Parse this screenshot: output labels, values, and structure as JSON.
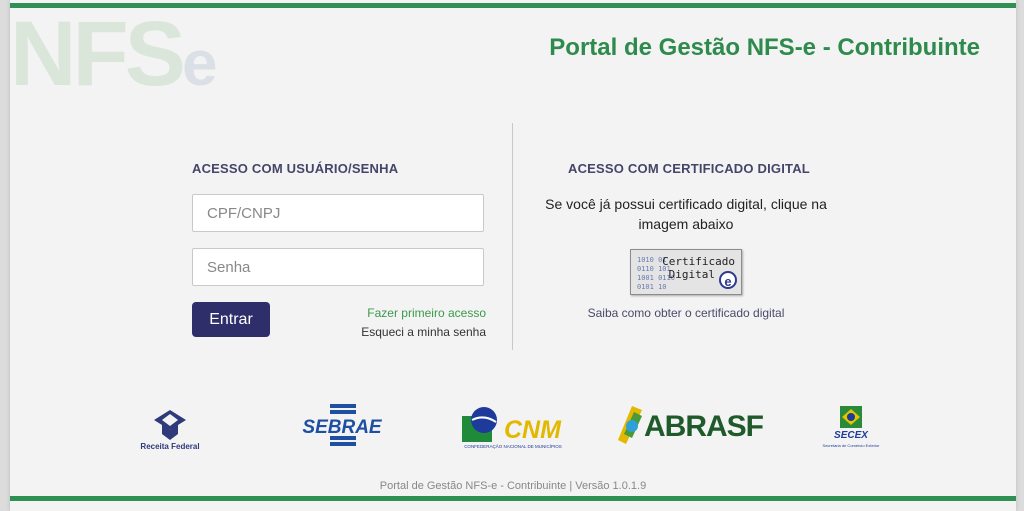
{
  "brand": {
    "watermark": "NFS",
    "watermark_e": "e"
  },
  "header": {
    "title": "Portal de Gestão NFS-e - Contribuinte"
  },
  "login": {
    "heading": "ACESSO COM USUÁRIO/SENHA",
    "cpf_placeholder": "CPF/CNPJ",
    "password_placeholder": "Senha",
    "submit_label": "Entrar",
    "first_access_link": "Fazer primeiro acesso",
    "forgot_password_link": "Esqueci a minha senha"
  },
  "certificate": {
    "heading": "ACESSO COM CERTIFICADO DIGITAL",
    "instructions": "Se você já possui certificado digital, clique na imagem abaixo",
    "badge_line1": "Certificado",
    "badge_line2": "Digital",
    "badge_e": "e",
    "help_link": "Saiba como obter o certificado digital"
  },
  "partners": {
    "receita": "Receita Federal",
    "sebrae": "SEBRAE",
    "cnm": "CNM",
    "cnm_sub": "CONFEDERAÇÃO NACIONAL DE MUNICÍPIOS",
    "abrasf": "ABRASF",
    "secex": "SECEX",
    "secex_sub": "Secretaria de Comércio Exterior"
  },
  "footer": {
    "text": "Portal de Gestão NFS-e - Contribuinte | Versão 1.0.1.9"
  },
  "colors": {
    "green": "#2e9153",
    "navy": "#2e2e6b",
    "link_green": "#3a9a4c"
  }
}
